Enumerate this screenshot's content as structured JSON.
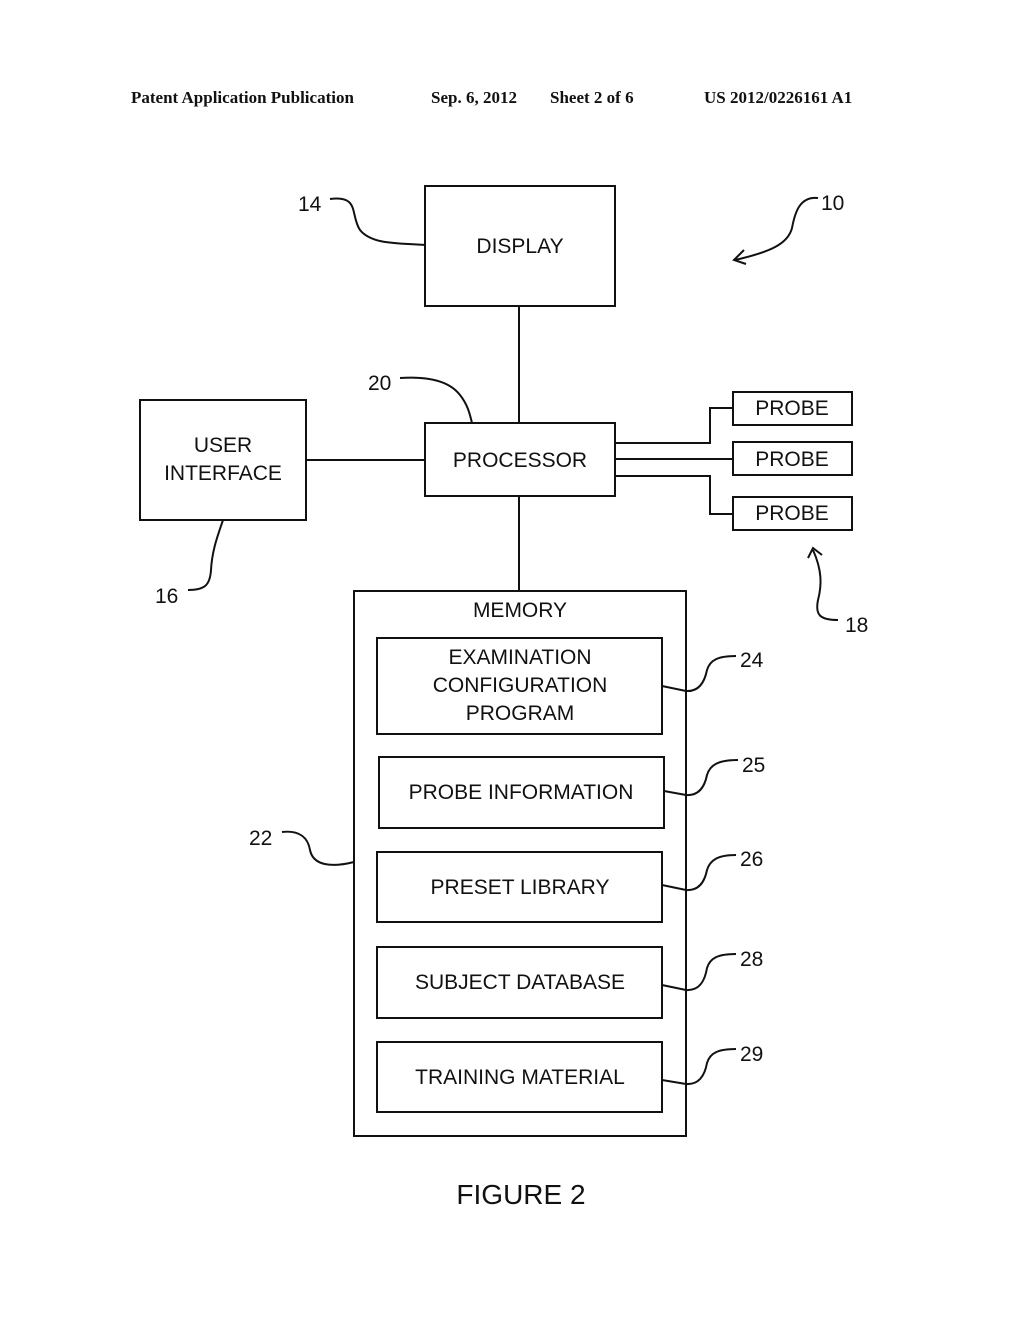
{
  "header": {
    "publication": "Patent Application Publication",
    "date": "Sep. 6, 2012",
    "sheet": "Sheet 2 of 6",
    "number": "US 2012/0226161 A1"
  },
  "diagram": {
    "system_ref": "10",
    "display": {
      "label": "DISPLAY",
      "ref": "14"
    },
    "processor": {
      "label": "PROCESSOR",
      "ref": "20"
    },
    "user_interface": {
      "lines": [
        "USER",
        "INTERFACE"
      ],
      "ref": "16"
    },
    "probes": {
      "items": [
        "PROBE",
        "PROBE",
        "PROBE"
      ],
      "ref": "18"
    },
    "memory": {
      "label": "MEMORY",
      "ref": "22",
      "modules": [
        {
          "lines": [
            "EXAMINATION",
            "CONFIGURATION",
            "PROGRAM"
          ],
          "ref": "24"
        },
        {
          "lines": [
            "PROBE INFORMATION"
          ],
          "ref": "25"
        },
        {
          "lines": [
            "PRESET LIBRARY"
          ],
          "ref": "26"
        },
        {
          "lines": [
            "SUBJECT DATABASE"
          ],
          "ref": "28"
        },
        {
          "lines": [
            "TRAINING MATERIAL"
          ],
          "ref": "29"
        }
      ]
    }
  },
  "caption": "FIGURE 2"
}
